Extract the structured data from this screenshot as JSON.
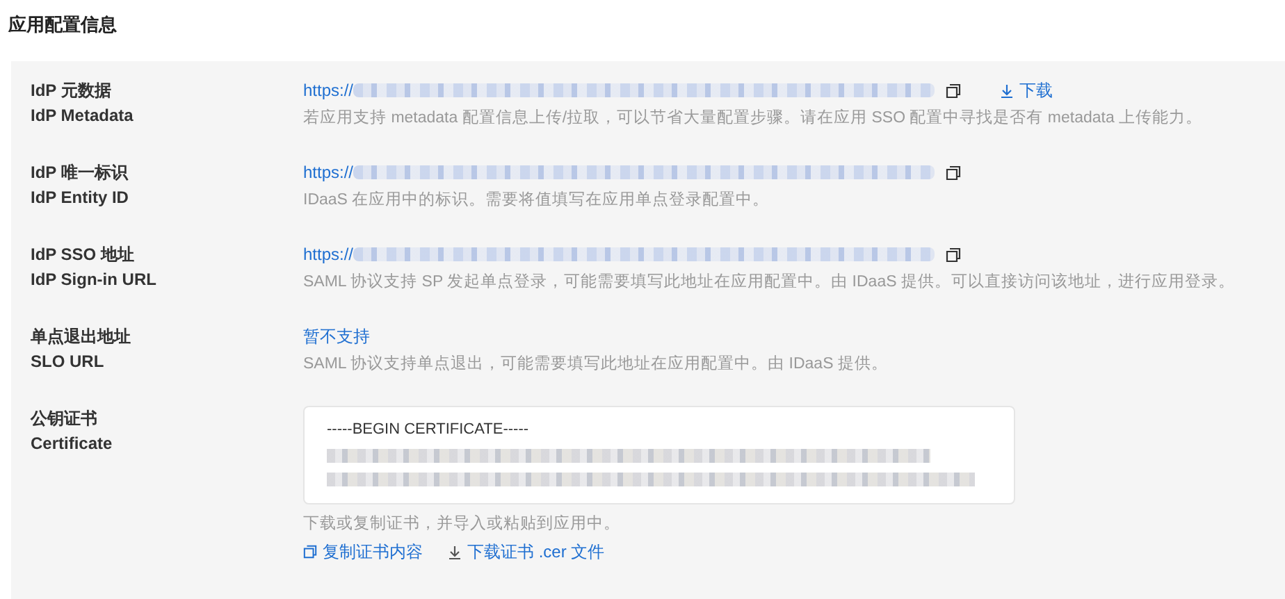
{
  "title": "应用配置信息",
  "rows": [
    {
      "kind": "url",
      "label_cn": "IdP 元数据",
      "label_en": "IdP Metadata",
      "value": "https://",
      "download": "下载",
      "hint": "若应用支持 metadata 配置信息上传/拉取，可以节省大量配置步骤。请在应用 SSO 配置中寻找是否有 metadata 上传能力。"
    },
    {
      "kind": "url",
      "label_cn": "IdP 唯一标识",
      "label_en": "IdP Entity ID",
      "value": "https://",
      "hint": "IDaaS 在应用中的标识。需要将值填写在应用单点登录配置中。"
    },
    {
      "kind": "url",
      "label_cn": "IdP SSO 地址",
      "label_en": "IdP Sign-in URL",
      "value": "https://",
      "hint": "SAML 协议支持 SP 发起单点登录，可能需要填写此地址在应用配置中。由 IDaaS 提供。可以直接访问该地址，进行应用登录。"
    },
    {
      "kind": "text",
      "label_cn": "单点退出地址",
      "label_en": "SLO URL",
      "value": "暂不支持",
      "hint": "SAML 协议支持单点退出，可能需要填写此地址在应用配置中。由 IDaaS 提供。"
    },
    {
      "kind": "certificate",
      "label_cn": "公钥证书",
      "label_en": "Certificate",
      "value": "-----BEGIN CERTIFICATE-----",
      "hint": "下载或复制证书，并导入或粘贴到应用中。",
      "actions": [
        "复制证书内容",
        "下载证书 .cer 文件"
      ]
    }
  ]
}
